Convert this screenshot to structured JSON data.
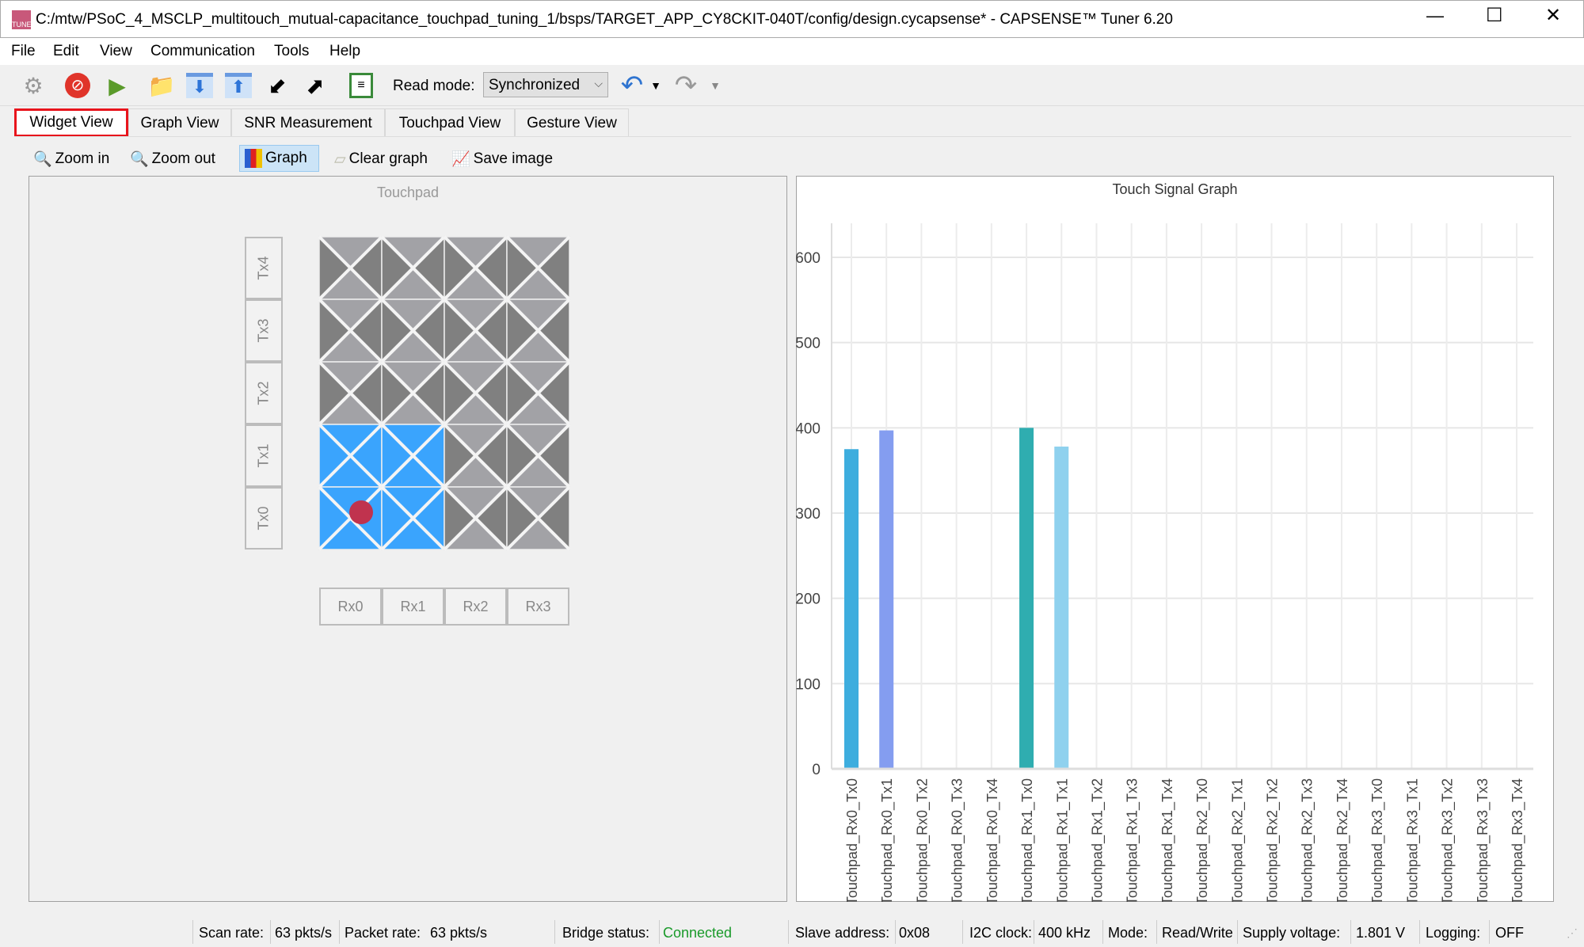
{
  "window": {
    "title": "C:/mtw/PSoC_4_MSCLP_multitouch_mutual-capacitance_touchpad_tuning_1/bsps/TARGET_APP_CY8CKIT-040T/config/design.cycapsense* - CAPSENSE™ Tuner 6.20",
    "app_icon": "tuner-icon"
  },
  "menu": [
    "File",
    "Edit",
    "View",
    "Communication",
    "Tools",
    "Help"
  ],
  "toolbar": {
    "read_mode_label": "Read mode:",
    "read_mode_value": "Synchronized"
  },
  "tabs": [
    "Widget View",
    "Graph View",
    "SNR Measurement",
    "Touchpad View",
    "Gesture View"
  ],
  "active_tab": "Widget View",
  "subtoolbar": {
    "zoom_in": "Zoom in",
    "zoom_out": "Zoom out",
    "graph": "Graph",
    "clear_graph": "Clear graph",
    "save_image": "Save image"
  },
  "widget": {
    "title": "Touchpad",
    "tx": [
      "Tx4",
      "Tx3",
      "Tx2",
      "Tx1",
      "Tx0"
    ],
    "rx": [
      "Rx0",
      "Rx1",
      "Rx2",
      "Rx3"
    ],
    "active_cells": [
      [
        "Rx0",
        "Tx0"
      ],
      [
        "Rx1",
        "Tx0"
      ],
      [
        "Rx0",
        "Tx1"
      ],
      [
        "Rx1",
        "Tx1"
      ]
    ],
    "touch_position": "Rx0/Tx0",
    "colors": {
      "active": "#3aa4fd",
      "dark": "#808080",
      "light": "#a2a2a6",
      "touch": "#c0334e"
    }
  },
  "chart_data": {
    "type": "bar",
    "title": "Touch Signal Graph",
    "ylim": [
      0,
      640
    ],
    "yticks": [
      0,
      100,
      200,
      300,
      400,
      500,
      600
    ],
    "grid": true,
    "categories": [
      "Touchpad_Rx0_Tx0",
      "Touchpad_Rx0_Tx1",
      "Touchpad_Rx0_Tx2",
      "Touchpad_Rx0_Tx3",
      "Touchpad_Rx0_Tx4",
      "Touchpad_Rx1_Tx0",
      "Touchpad_Rx1_Tx1",
      "Touchpad_Rx1_Tx2",
      "Touchpad_Rx1_Tx3",
      "Touchpad_Rx1_Tx4",
      "Touchpad_Rx2_Tx0",
      "Touchpad_Rx2_Tx1",
      "Touchpad_Rx2_Tx2",
      "Touchpad_Rx2_Tx3",
      "Touchpad_Rx2_Tx4",
      "Touchpad_Rx3_Tx0",
      "Touchpad_Rx3_Tx1",
      "Touchpad_Rx3_Tx2",
      "Touchpad_Rx3_Tx3",
      "Touchpad_Rx3_Tx4"
    ],
    "values": [
      375,
      397,
      0,
      0,
      0,
      400,
      378,
      0,
      0,
      0,
      0,
      0,
      0,
      0,
      0,
      0,
      0,
      0,
      0,
      0
    ],
    "colors": [
      "#3dadde",
      "#849df0",
      "#3dadde",
      "#3dadde",
      "#3dadde",
      "#2fadb0",
      "#8fd1ee",
      "#3dadde",
      "#3dadde",
      "#3dadde",
      "#3dadde",
      "#3dadde",
      "#3dadde",
      "#3dadde",
      "#3dadde",
      "#3dadde",
      "#3dadde",
      "#3dadde",
      "#3dadde",
      "#3dadde"
    ]
  },
  "status": {
    "scan_rate_label": "Scan rate:",
    "scan_rate": "63 pkts/s",
    "packet_rate_label": "Packet rate:",
    "packet_rate": "63 pkts/s",
    "bridge_label": "Bridge status:",
    "bridge": "Connected",
    "slave_label": "Slave address:",
    "slave": "0x08",
    "i2c_label": "I2C clock:",
    "i2c": "400 kHz",
    "mode_label": "Mode:",
    "mode": "Read/Write",
    "supply_label": "Supply voltage:",
    "supply": "1.801 V",
    "logging_label": "Logging:",
    "logging": "OFF",
    "connected_color": "#1a9a2a"
  }
}
